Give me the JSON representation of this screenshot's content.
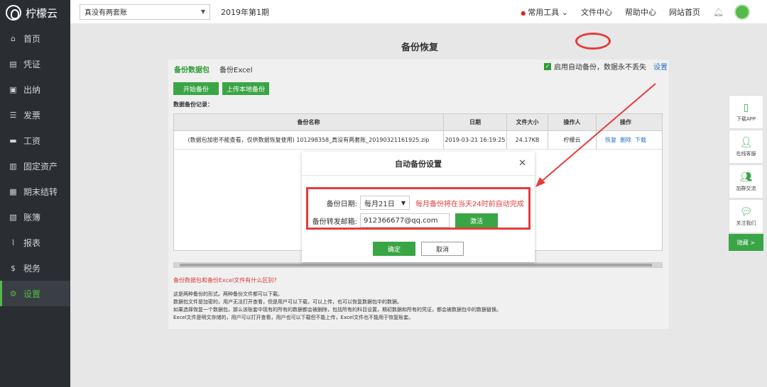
{
  "app": {
    "name": "柠檬云"
  },
  "sidebar": {
    "items": [
      {
        "label": "首页",
        "icon": "home-icon",
        "glyph": "⌂"
      },
      {
        "label": "凭证",
        "icon": "voucher-icon",
        "glyph": "▤"
      },
      {
        "label": "出纳",
        "icon": "cashier-icon",
        "glyph": "▣"
      },
      {
        "label": "发票",
        "icon": "invoice-icon",
        "glyph": "☰"
      },
      {
        "label": "工资",
        "icon": "salary-icon",
        "glyph": "▬"
      },
      {
        "label": "固定资产",
        "icon": "assets-icon",
        "glyph": "▥"
      },
      {
        "label": "期末结转",
        "icon": "period-close-icon",
        "glyph": "▦"
      },
      {
        "label": "账簿",
        "icon": "ledger-icon",
        "glyph": "▧"
      },
      {
        "label": "报表",
        "icon": "report-icon",
        "glyph": "⌇"
      },
      {
        "label": "税务",
        "icon": "tax-icon",
        "glyph": "$"
      },
      {
        "label": "设置",
        "icon": "gear-icon",
        "glyph": "⚙"
      }
    ],
    "active_index": 10
  },
  "topbar": {
    "account": "真没有两套账",
    "period": "2019年第1期",
    "nav": [
      "常用工具",
      "文件中心",
      "帮助中心",
      "网站首页"
    ]
  },
  "page": {
    "title": "备份恢复",
    "tabs": [
      "备份数据包",
      "备份Excel"
    ],
    "auto_backup_text": "启用自动备份，数据永不丢失",
    "settings_link": "设置",
    "buttons": {
      "start_backup": "开始备份",
      "upload_local": "上传本地备份"
    },
    "records_label": "数据备份记录：",
    "table": {
      "headers": [
        "备份名称",
        "日期",
        "文件大小",
        "操作人",
        "操作"
      ],
      "rows": [
        {
          "name": "(数据包加密不能查看，仅供数据恢复使用) 101298358_真没有两套账_20190321161925.zip",
          "date": "2019-03-21 16:19:25",
          "size": "24.17KB",
          "operator": "柠檬云",
          "actions": [
            "恢复",
            "删除",
            "下载"
          ]
        }
      ]
    },
    "help_link": "备份数据包和备份Excel文件有什么区别?",
    "help_lines": [
      "这是两种备份的形式。两种备份文件都可以下载。",
      "数据包文件是加密的，用户无法打开查看，但是用户可以下载，可以上传，也可以恢复数据包中的数据。",
      "如果选择恢复一个数据包，那么该账套中现有的所有的数据都会被删除，包括所有的科目设置，期初数据和所有的凭证，都会被数据包中的数据替换。",
      "Excel文件是明文存储的，用户可以打开查看，用户也可以下载但不能上传，Excel文件也不能用于恢复账套。"
    ]
  },
  "modal": {
    "title": "自动备份设置",
    "date_label": "备份日期:",
    "date_value": "每月21日",
    "date_hint": "每月备份将在当天24时前自动完成",
    "email_label": "备份转发邮箱:",
    "email_value": "912366677@qq.com",
    "activate": "激活",
    "ok": "确定",
    "cancel": "取消"
  },
  "float_panel": {
    "items": [
      "下载APP",
      "在线客服",
      "加群交流",
      "关注我们"
    ],
    "hide": "隐藏 >"
  },
  "colors": {
    "accent": "#3aa545",
    "annotation": "#e53c3c",
    "link": "#2b6fc7"
  }
}
